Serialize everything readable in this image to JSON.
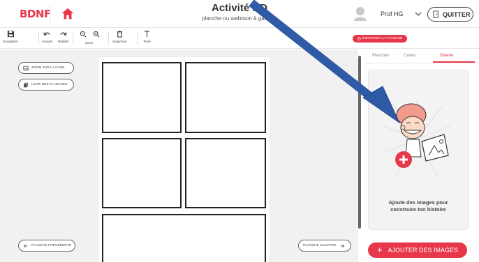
{
  "header": {
    "logo": "BDNF",
    "title": "Activité BD",
    "subtitle": "planche ou webtoon à gaufrier",
    "user_name": "Prof HG",
    "quit_label": "QUITTER"
  },
  "toolbar": {
    "save": "Enregistrer",
    "undo": "Annuler",
    "redo": "Rétablir",
    "zoom": "Zoom",
    "delete": "Supprimer",
    "text": "Texte",
    "export": "EXPORTER LA PLANCHE"
  },
  "left": {
    "zoom_case": "ZOOM SUR LA CASE",
    "list_planches": "LISTE DES PLANCHES",
    "prev": "PLANCHE PRÉCÉDENTE",
    "next": "PLANCHE SUIVANTE"
  },
  "right": {
    "tabs": [
      "Planches",
      "Cases",
      "Galerie"
    ],
    "active_tab": "Galerie",
    "gallery_text_1": "Ajoute des images pour",
    "gallery_text_2": "construire ton histoire",
    "add_images": "AJOUTER DES IMAGES"
  },
  "colors": {
    "accent": "#e8374a",
    "arrow": "#2e5aa6"
  }
}
